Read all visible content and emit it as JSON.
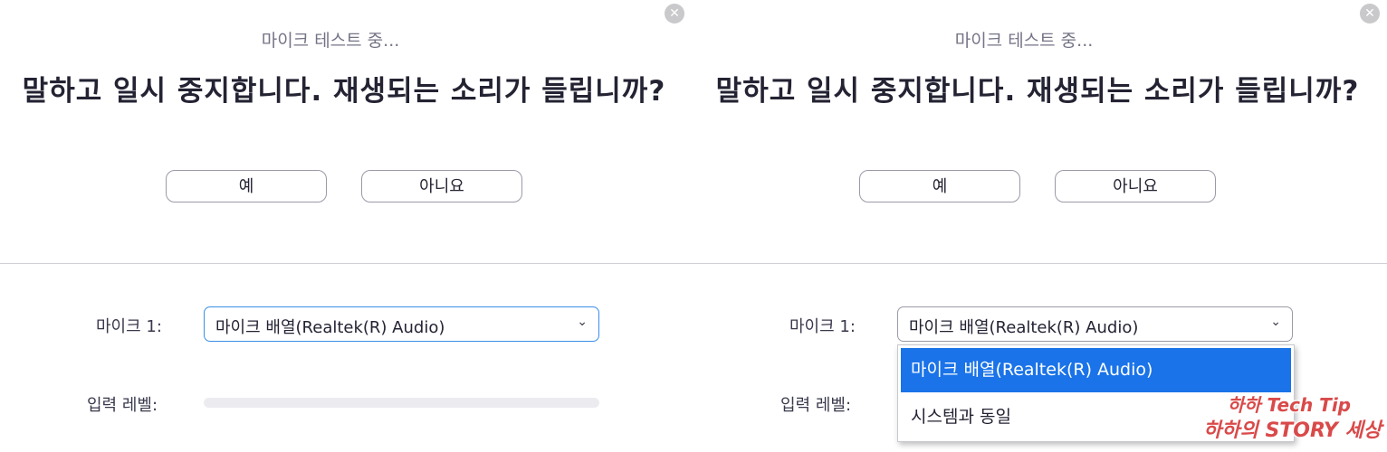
{
  "panels": [
    {
      "subtitle": "마이크 테스트 중...",
      "question": "말하고 일시 중지합니다. 재생되는 소리가 들립니까?",
      "yes_label": "예",
      "no_label": "아니요",
      "mic_label": "마이크 1:",
      "mic_value": "마이크 배열(Realtek(R) Audio)",
      "level_label": "입력 레벨:",
      "level_value": 0
    },
    {
      "subtitle": "마이크 테스트 중...",
      "question": "말하고 일시 중지합니다. 재생되는 소리가 들립니까?",
      "yes_label": "예",
      "no_label": "아니요",
      "mic_label": "마이크 1:",
      "mic_value": "마이크 배열(Realtek(R) Audio)",
      "level_label": "입력 레벨:",
      "dropdown_options": [
        "마이크 배열(Realtek(R) Audio)",
        "시스템과 동일"
      ],
      "dropdown_selected_index": 0
    }
  ],
  "icons": {
    "close": "close-icon",
    "chevron": "chevron-down-icon"
  },
  "colors": {
    "accent": "#2d8cff",
    "selected_option_bg": "#1a73e8",
    "watermark": "#d94a4a"
  },
  "watermark": {
    "line1": "하하 Tech Tip",
    "line2": "하하의 STORY 세상"
  }
}
